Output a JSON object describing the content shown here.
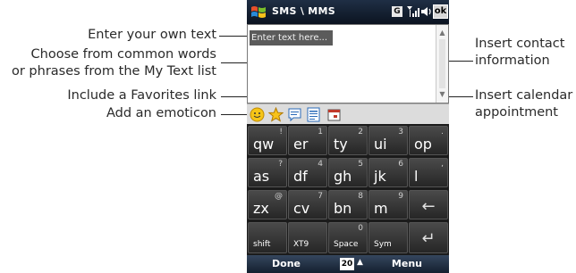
{
  "callouts": {
    "own_text": "Enter your own text",
    "common_words_line1": "Choose from common words",
    "common_words_line2": "or phrases from the My Text list",
    "favorites": "Include a Favorites link",
    "emoticon": "Add an emoticon",
    "contact_line1": "Insert contact",
    "contact_line2": "information",
    "calendar_line1": "Insert calendar",
    "calendar_line2": "appointment"
  },
  "titlebar": {
    "title": "SMS \\ MMS",
    "network_badge": "G",
    "ok_label": "ok"
  },
  "compose": {
    "placeholder": "Enter text here..."
  },
  "toolbar": {
    "icons": [
      "emoticon-icon",
      "favorites-star-icon",
      "my-text-icon",
      "contact-card-icon",
      "calendar-icon"
    ]
  },
  "keyboard": {
    "rows": [
      [
        {
          "main": "qw",
          "sub": "!"
        },
        {
          "main": "er",
          "sub": "1"
        },
        {
          "main": "ty",
          "sub": "2"
        },
        {
          "main": "ui",
          "sub": "3"
        },
        {
          "main": "op",
          "sub": "."
        }
      ],
      [
        {
          "main": "as",
          "sub": "?"
        },
        {
          "main": "df",
          "sub": "4"
        },
        {
          "main": "gh",
          "sub": "5"
        },
        {
          "main": "jk",
          "sub": "6"
        },
        {
          "main": "l",
          "sub": ","
        }
      ],
      [
        {
          "main": "zx",
          "sub": "@"
        },
        {
          "main": "cv",
          "sub": "7"
        },
        {
          "main": "bn",
          "sub": "8"
        },
        {
          "main": "m",
          "sub": "9"
        },
        {
          "glyph": "←"
        }
      ],
      [
        {
          "small": "shift"
        },
        {
          "small": "XT9"
        },
        {
          "small": "Space",
          "sub": "0"
        },
        {
          "small": "Sym"
        },
        {
          "glyph": "↵"
        }
      ]
    ]
  },
  "softkeys": {
    "left": "Done",
    "count": "20",
    "caret": "▲",
    "right": "Menu"
  },
  "colors": {
    "titlebar": "#0b1320",
    "keyboard_bg": "#1b1b1b",
    "toolbar_bg": "#dcdcdc"
  }
}
